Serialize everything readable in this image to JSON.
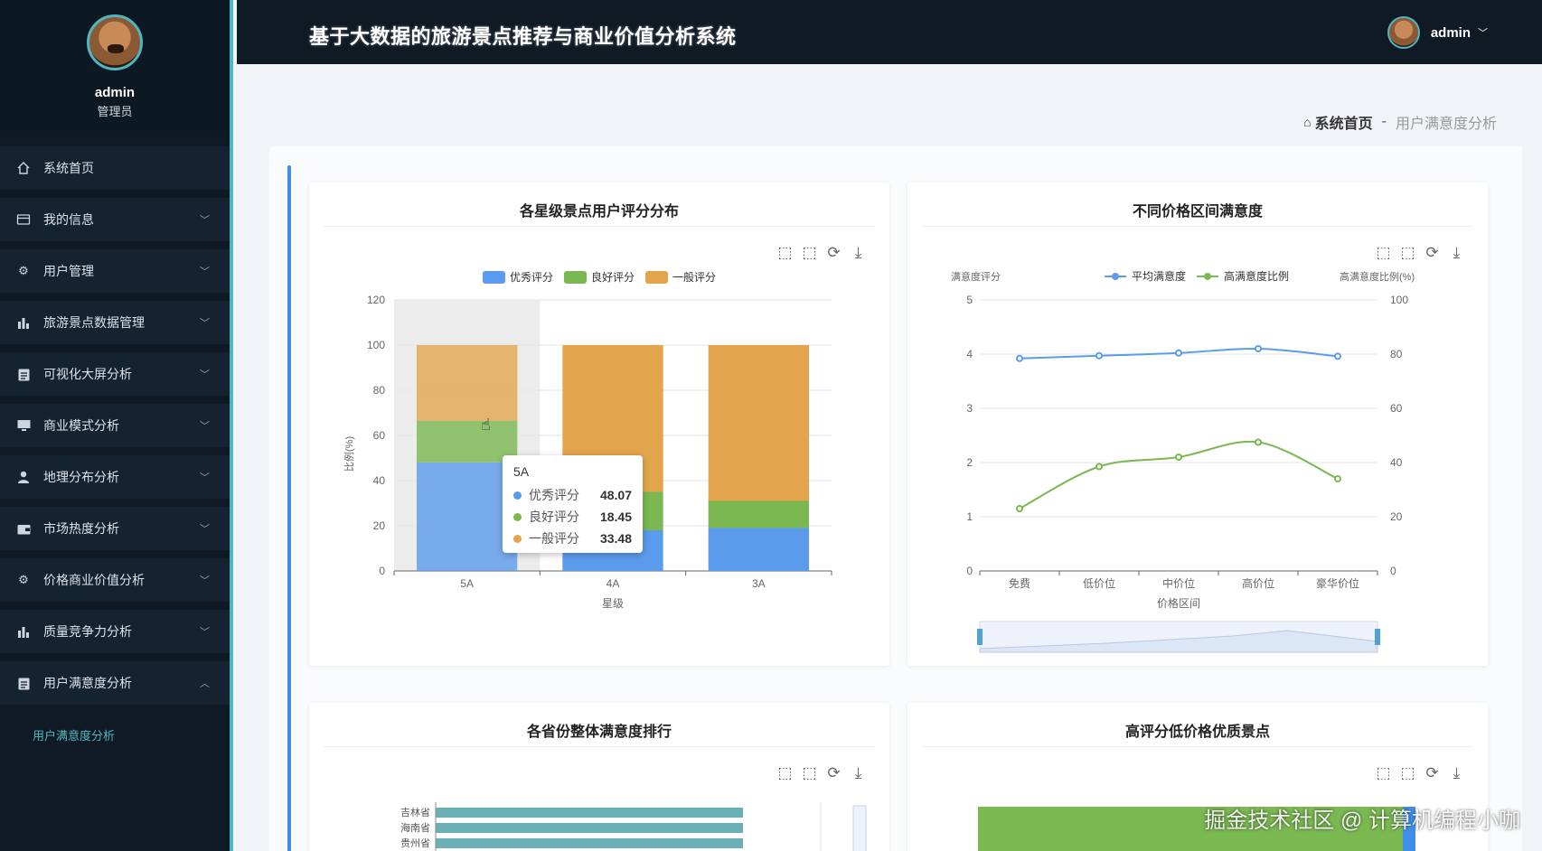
{
  "app": {
    "title": "基于大数据的旅游景点推荐与商业价值分析系统"
  },
  "profile": {
    "name": "admin",
    "role": "管理员"
  },
  "header": {
    "username": "admin"
  },
  "sidebar": {
    "items": [
      {
        "label": "系统首页",
        "icon": "home-icon"
      },
      {
        "label": "我的信息",
        "icon": "card-icon"
      },
      {
        "label": "用户管理",
        "icon": "gear-icon"
      },
      {
        "label": "旅游景点数据管理",
        "icon": "bar-chart-icon"
      },
      {
        "label": "可视化大屏分析",
        "icon": "clipboard-icon"
      },
      {
        "label": "商业模式分析",
        "icon": "monitor-icon"
      },
      {
        "label": "地理分布分析",
        "icon": "user-icon"
      },
      {
        "label": "市场热度分析",
        "icon": "wallet-icon"
      },
      {
        "label": "价格商业价值分析",
        "icon": "gear-icon"
      },
      {
        "label": "质量竞争力分析",
        "icon": "bar-chart-icon"
      },
      {
        "label": "用户满意度分析",
        "icon": "clipboard-icon"
      }
    ],
    "sub_item": "用户满意度分析"
  },
  "breadcrumb": {
    "home": "系统首页",
    "separator": "-",
    "current": "用户满意度分析"
  },
  "cards": {
    "c1_title": "各星级景点用户评分分布",
    "c2_title": "不同价格区间满意度",
    "c3_title": "各省份整体满意度排行",
    "c4_title": "高评分低价格优质景点"
  },
  "tooltip": {
    "title": "5A",
    "rows": [
      {
        "name": "优秀评分",
        "value": "48.07",
        "color": "#5b9bec"
      },
      {
        "name": "良好评分",
        "value": "18.45",
        "color": "#7ab851"
      },
      {
        "name": "一般评分",
        "value": "33.48",
        "color": "#e2a54c"
      }
    ]
  },
  "watermark": "掘金技术社区 @ 计算机编程小咖",
  "chart_data": [
    {
      "type": "bar",
      "stacked": true,
      "title": "各星级景点用户评分分布",
      "categories": [
        "5A",
        "4A",
        "3A"
      ],
      "series": [
        {
          "name": "优秀评分",
          "values": [
            48.07,
            18,
            19
          ],
          "color": "#5b9bec"
        },
        {
          "name": "良好评分",
          "values": [
            18.45,
            17,
            12
          ],
          "color": "#7ab851"
        },
        {
          "name": "一般评分",
          "values": [
            33.48,
            65,
            69
          ],
          "color": "#e2a54c"
        }
      ],
      "xlabel": "星级",
      "ylabel": "比例(%)",
      "ylim": [
        0,
        120
      ],
      "yticks": [
        0,
        20,
        40,
        60,
        80,
        100,
        120
      ],
      "legend_position": "top",
      "highlighted_category": "5A"
    },
    {
      "type": "line",
      "title": "不同价格区间满意度",
      "categories": [
        "免费",
        "低价位",
        "中价位",
        "高价位",
        "豪华价位"
      ],
      "series": [
        {
          "name": "平均满意度",
          "axis": "left",
          "values": [
            3.92,
            3.97,
            4.02,
            4.1,
            3.96
          ],
          "color": "#5b9bec"
        },
        {
          "name": "高满意度比例",
          "axis": "right",
          "values": [
            23,
            38.5,
            42,
            47.5,
            34
          ],
          "color": "#7ab851"
        }
      ],
      "xlabel": "价格区间",
      "ylabel_left": "满意度评分",
      "ylabel_right": "高满意度比例(%)",
      "ylim_left": [
        0,
        5
      ],
      "yticks_left": [
        0,
        1,
        2,
        3,
        4,
        5
      ],
      "ylim_right": [
        0,
        100
      ],
      "yticks_right": [
        0,
        20,
        40,
        60,
        80,
        100
      ],
      "legend_position": "top",
      "has_datazoom": true
    },
    {
      "type": "bar",
      "orientation": "horizontal",
      "title": "各省份整体满意度排行",
      "categories": [
        "吉林省",
        "海南省",
        "贵州省"
      ],
      "partially_visible": true
    },
    {
      "type": "bar",
      "title": "高评分低价格优质景点",
      "partially_visible": true
    }
  ]
}
